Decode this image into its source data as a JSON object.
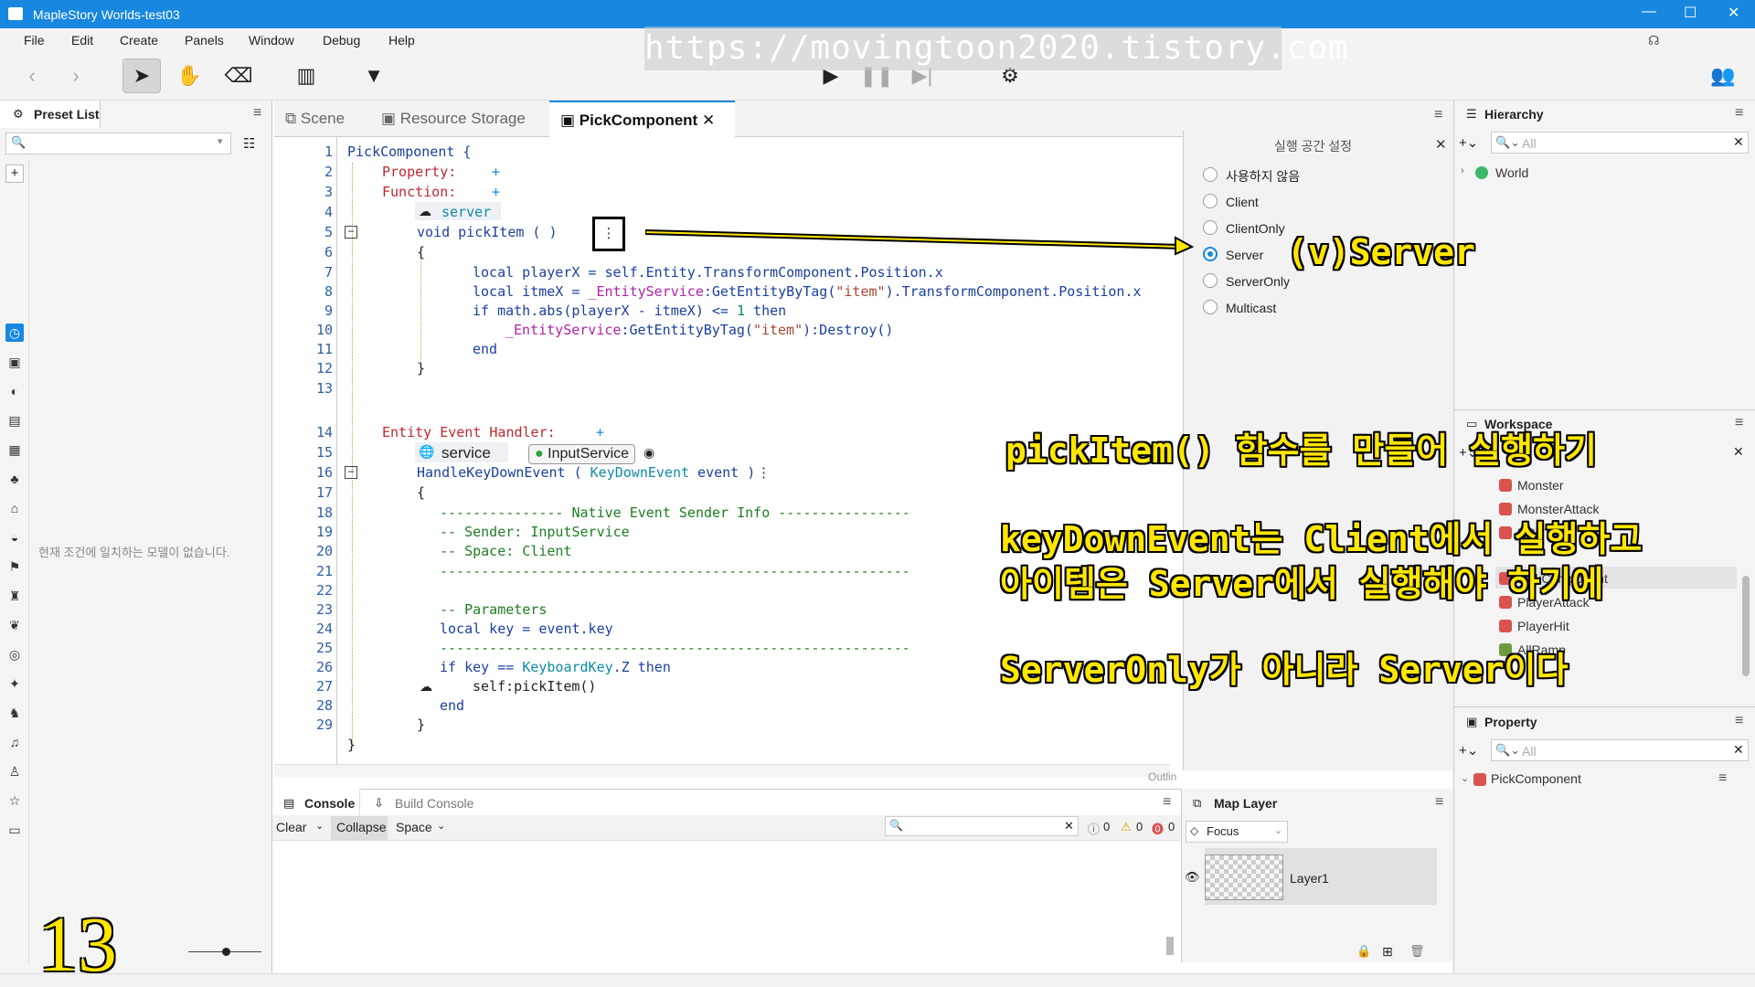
{
  "window": {
    "title": "MapleStory Worlds-test03"
  },
  "menu": [
    "File",
    "Edit",
    "Create",
    "Panels",
    "Window",
    "Debug",
    "Help"
  ],
  "watermark": "https://movingtoon2020.tistory.com",
  "preset_panel": {
    "title": "Preset List",
    "empty_text": "현재 조건에 일치하는 모델이 없습니다."
  },
  "tabs": [
    {
      "label": "Scene"
    },
    {
      "label": "Resource Storage"
    },
    {
      "label": "PickComponent"
    }
  ],
  "code": {
    "line_numbers": [
      "1",
      "2",
      "3",
      "4",
      "5",
      "6",
      "7",
      "8",
      "9",
      "10",
      "11",
      "12",
      "13",
      "14",
      "15",
      "16",
      "17",
      "18",
      "19",
      "20",
      "21",
      "22",
      "23",
      "24",
      "25",
      "26",
      "27",
      "28",
      "29"
    ],
    "component": "PickComponent {",
    "property": "Property:",
    "function": "Function:",
    "server_tag": "server",
    "func_decl": "void pickItem ( )",
    "open_brace": "{",
    "close_brace": "}",
    "l7": "local playerX = self.Entity.TransformComponent.Position.x",
    "l8a": "local itmeX = ",
    "l8b": "_EntityService",
    "l8c": ":GetEntityByTag(",
    "l8d": "\"item\"",
    "l8e": ").TransformComponent.Position.x",
    "l9a": "if math.abs(playerX - itmeX) <= ",
    "l9b": "1",
    "l9c": " then",
    "l10a": "_EntityService",
    "l10b": ":GetEntityByTag(",
    "l10c": "\"item\"",
    "l10d": "):Destroy()",
    "l11": "end",
    "handler": "Entity Event Handler:",
    "service_tag": "service",
    "input_service": "InputService",
    "l16a": "HandleKeyDownEvent ( ",
    "l16b": "KeyDownEvent",
    "l16c": " event )",
    "l18": "--------------- Native Event Sender Info ----------------",
    "l19": "-- Sender: InputService",
    "l20": "-- Space: Client",
    "l21": "---------------------------------------------------------",
    "l23": "-- Parameters",
    "l24": "local key = event.key",
    "l25": "---------------------------------------------------------",
    "l26a": "if key == ",
    "l26b": "KeyboardKey",
    "l26c": ".Z then",
    "l27": "self:pickItem()",
    "l28": "end",
    "l29": "}",
    "l29b": "}",
    "plus": "+",
    "dots": "⋮"
  },
  "exec_panel": {
    "title": "실행 공간 설정",
    "options": [
      "사용하지 않음",
      "Client",
      "ClientOnly",
      "Server",
      "ServerOnly",
      "Multicast"
    ],
    "selected": "Server",
    "outline": "Outlin"
  },
  "hierarchy": {
    "title": "Hierarchy",
    "search_placeholder": "All",
    "root": "World"
  },
  "workspace": {
    "title": "Workspace",
    "items": [
      "Monster",
      "MonsterAttack",
      "NPCTalk",
      "PickComponent",
      "PlayerAttack",
      "PlayerHit",
      "AllRamp"
    ]
  },
  "property": {
    "title": "Property",
    "search_placeholder": "All",
    "item": "PickComponent"
  },
  "console": {
    "tabs": [
      "Console",
      "Build Console"
    ],
    "buttons": [
      "Clear",
      "Collapse",
      "Space"
    ],
    "counts": [
      "0",
      "0",
      "0"
    ]
  },
  "map_layer": {
    "title": "Map Layer",
    "focus": "Focus",
    "layer": "Layer1"
  },
  "overlays": {
    "server_label": "(v)Server",
    "line1": "pickItem() 함수를 만들어 실행하기",
    "line2": "keyDownEvent는 Client에서 실행하고",
    "line3": "아이템은 Server에서 실행해야 하기에",
    "line4": "ServerOnly가 아니라 Server이다",
    "step": "13"
  },
  "colors": {
    "accent": "#1787e0",
    "overlay_text": "#ffe600"
  }
}
